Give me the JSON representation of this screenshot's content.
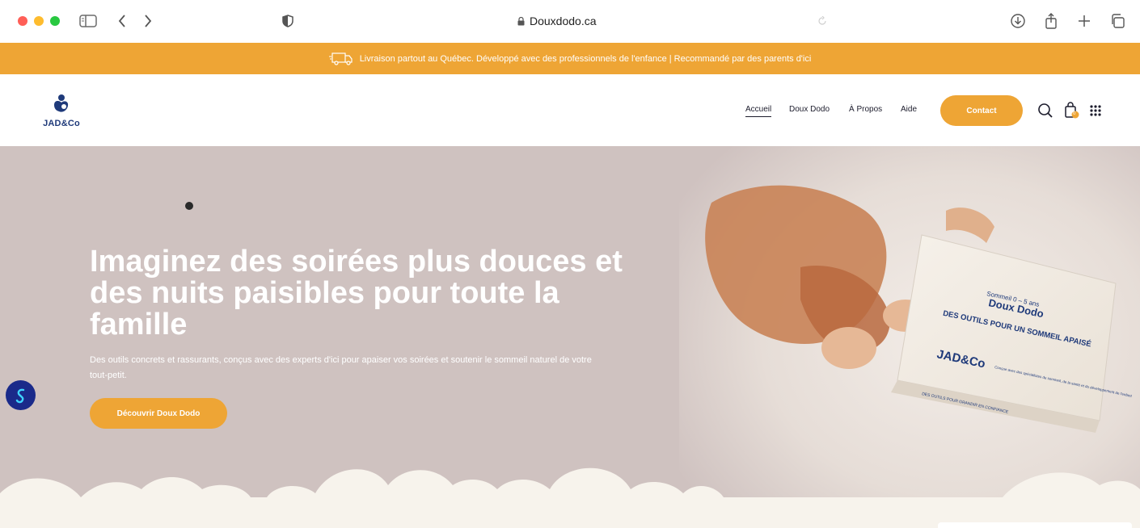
{
  "browser": {
    "url": "Douxdodo.ca"
  },
  "announcement": {
    "text": "Livraison partout au Québec. Développé avec des professionnels de l'enfance | Recommandé par des parents d'ici"
  },
  "header": {
    "logo_text": "JAD&Co",
    "nav": [
      {
        "label": "Accueil"
      },
      {
        "label": "Doux Dodo"
      },
      {
        "label": "À Propos"
      },
      {
        "label": "Aide"
      }
    ],
    "contact_label": "Contact",
    "cart_count": "0"
  },
  "hero": {
    "title": "Imaginez des soirées plus douces et des nuits paisibles pour toute la famille",
    "subtitle": "Des outils concrets et rassurants, conçus avec des experts d'ici pour apaiser vos soirées et soutenir le sommeil naturel de votre tout-petit.",
    "cta_label": "Découvrir Doux Dodo",
    "box": {
      "age_label": "Sommeil 0 – 5 ans",
      "brand": "Doux Dodo",
      "tagline": "DES OUTILS POUR UN SOMMEIL APAISÉ",
      "logo": "JAD&Co",
      "note": "Conçue avec des spécialistes du sommeil, de la santé et du développement de l'enfant",
      "side_text": "DES OUTILS POUR GRANDIR EN CONFIANCE"
    }
  },
  "colors": {
    "accent": "#eea535",
    "hero_bg": "#cfc2c0",
    "logo_blue": "#1f3a7a",
    "cloud": "#f7f3ec"
  }
}
